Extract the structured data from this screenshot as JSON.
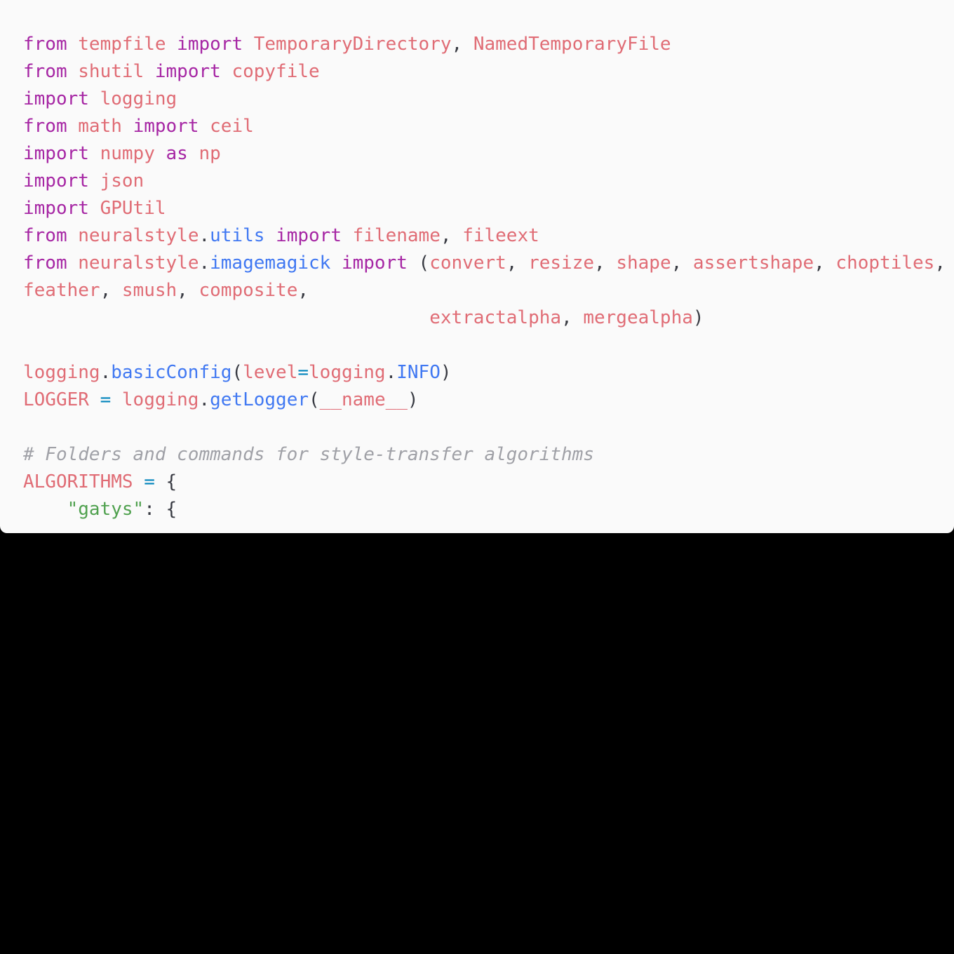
{
  "theme": {
    "background": "#fafafa",
    "outer_background": "#000000",
    "keyword_color": "#a626a4",
    "identifier_color": "#e06c75",
    "function_color": "#4078f2",
    "operator_color": "#0184bc",
    "string_color": "#50a14f",
    "comment_color": "#a0a1a7",
    "punctuation_color": "#383a42"
  },
  "code": {
    "lines": [
      [
        {
          "t": "from",
          "c": "kw"
        },
        {
          "t": " ",
          "c": "pn"
        },
        {
          "t": "tempfile",
          "c": "id"
        },
        {
          "t": " ",
          "c": "pn"
        },
        {
          "t": "import",
          "c": "kw"
        },
        {
          "t": " ",
          "c": "pn"
        },
        {
          "t": "TemporaryDirectory",
          "c": "id"
        },
        {
          "t": ", ",
          "c": "pn"
        },
        {
          "t": "NamedTemporaryFile",
          "c": "id"
        }
      ],
      [
        {
          "t": "from",
          "c": "kw"
        },
        {
          "t": " ",
          "c": "pn"
        },
        {
          "t": "shutil",
          "c": "id"
        },
        {
          "t": " ",
          "c": "pn"
        },
        {
          "t": "import",
          "c": "kw"
        },
        {
          "t": " ",
          "c": "pn"
        },
        {
          "t": "copyfile",
          "c": "id"
        }
      ],
      [
        {
          "t": "import",
          "c": "kw"
        },
        {
          "t": " ",
          "c": "pn"
        },
        {
          "t": "logging",
          "c": "id"
        }
      ],
      [
        {
          "t": "from",
          "c": "kw"
        },
        {
          "t": " ",
          "c": "pn"
        },
        {
          "t": "math",
          "c": "id"
        },
        {
          "t": " ",
          "c": "pn"
        },
        {
          "t": "import",
          "c": "kw"
        },
        {
          "t": " ",
          "c": "pn"
        },
        {
          "t": "ceil",
          "c": "id"
        }
      ],
      [
        {
          "t": "import",
          "c": "kw"
        },
        {
          "t": " ",
          "c": "pn"
        },
        {
          "t": "numpy",
          "c": "id"
        },
        {
          "t": " ",
          "c": "pn"
        },
        {
          "t": "as",
          "c": "kw"
        },
        {
          "t": " ",
          "c": "pn"
        },
        {
          "t": "np",
          "c": "id"
        }
      ],
      [
        {
          "t": "import",
          "c": "kw"
        },
        {
          "t": " ",
          "c": "pn"
        },
        {
          "t": "json",
          "c": "id"
        }
      ],
      [
        {
          "t": "import",
          "c": "kw"
        },
        {
          "t": " ",
          "c": "pn"
        },
        {
          "t": "GPUtil",
          "c": "id"
        }
      ],
      [
        {
          "t": "from",
          "c": "kw"
        },
        {
          "t": " ",
          "c": "pn"
        },
        {
          "t": "neuralstyle",
          "c": "id"
        },
        {
          "t": ".",
          "c": "pn"
        },
        {
          "t": "utils",
          "c": "fn"
        },
        {
          "t": " ",
          "c": "pn"
        },
        {
          "t": "import",
          "c": "kw"
        },
        {
          "t": " ",
          "c": "pn"
        },
        {
          "t": "filename",
          "c": "id"
        },
        {
          "t": ", ",
          "c": "pn"
        },
        {
          "t": "fileext",
          "c": "id"
        }
      ],
      [
        {
          "t": "from",
          "c": "kw"
        },
        {
          "t": " ",
          "c": "pn"
        },
        {
          "t": "neuralstyle",
          "c": "id"
        },
        {
          "t": ".",
          "c": "pn"
        },
        {
          "t": "imagemagick",
          "c": "fn"
        },
        {
          "t": " ",
          "c": "pn"
        },
        {
          "t": "import",
          "c": "kw"
        },
        {
          "t": " (",
          "c": "pn"
        },
        {
          "t": "convert",
          "c": "id"
        },
        {
          "t": ", ",
          "c": "pn"
        },
        {
          "t": "resize",
          "c": "id"
        },
        {
          "t": ", ",
          "c": "pn"
        },
        {
          "t": "shape",
          "c": "id"
        },
        {
          "t": ", ",
          "c": "pn"
        },
        {
          "t": "assertshape",
          "c": "id"
        },
        {
          "t": ", ",
          "c": "pn"
        },
        {
          "t": "choptiles",
          "c": "id"
        },
        {
          "t": ",",
          "c": "pn"
        }
      ],
      [
        {
          "t": "feather",
          "c": "id"
        },
        {
          "t": ", ",
          "c": "pn"
        },
        {
          "t": "smush",
          "c": "id"
        },
        {
          "t": ", ",
          "c": "pn"
        },
        {
          "t": "composite",
          "c": "id"
        },
        {
          "t": ",",
          "c": "pn"
        }
      ],
      [
        {
          "t": "                                     ",
          "c": "pn"
        },
        {
          "t": "extractalpha",
          "c": "id"
        },
        {
          "t": ", ",
          "c": "pn"
        },
        {
          "t": "mergealpha",
          "c": "id"
        },
        {
          "t": ")",
          "c": "pn"
        }
      ],
      [],
      [
        {
          "t": "logging",
          "c": "id"
        },
        {
          "t": ".",
          "c": "pn"
        },
        {
          "t": "basicConfig",
          "c": "fn"
        },
        {
          "t": "(",
          "c": "pn"
        },
        {
          "t": "level",
          "c": "id"
        },
        {
          "t": "=",
          "c": "op"
        },
        {
          "t": "logging",
          "c": "id"
        },
        {
          "t": ".",
          "c": "pn"
        },
        {
          "t": "INFO",
          "c": "fn"
        },
        {
          "t": ")",
          "c": "pn"
        }
      ],
      [
        {
          "t": "LOGGER",
          "c": "id"
        },
        {
          "t": " ",
          "c": "pn"
        },
        {
          "t": "=",
          "c": "op"
        },
        {
          "t": " ",
          "c": "pn"
        },
        {
          "t": "logging",
          "c": "id"
        },
        {
          "t": ".",
          "c": "pn"
        },
        {
          "t": "getLogger",
          "c": "fn"
        },
        {
          "t": "(",
          "c": "pn"
        },
        {
          "t": "__name__",
          "c": "id"
        },
        {
          "t": ")",
          "c": "pn"
        }
      ],
      [],
      [
        {
          "t": "# Folders and commands for style-transfer algorithms",
          "c": "cm"
        }
      ],
      [
        {
          "t": "ALGORITHMS",
          "c": "id"
        },
        {
          "t": " ",
          "c": "pn"
        },
        {
          "t": "=",
          "c": "op"
        },
        {
          "t": " {",
          "c": "pn"
        }
      ],
      [
        {
          "t": "    ",
          "c": "pn"
        },
        {
          "t": "\"gatys\"",
          "c": "str"
        },
        {
          "t": ": {",
          "c": "pn"
        }
      ]
    ]
  }
}
